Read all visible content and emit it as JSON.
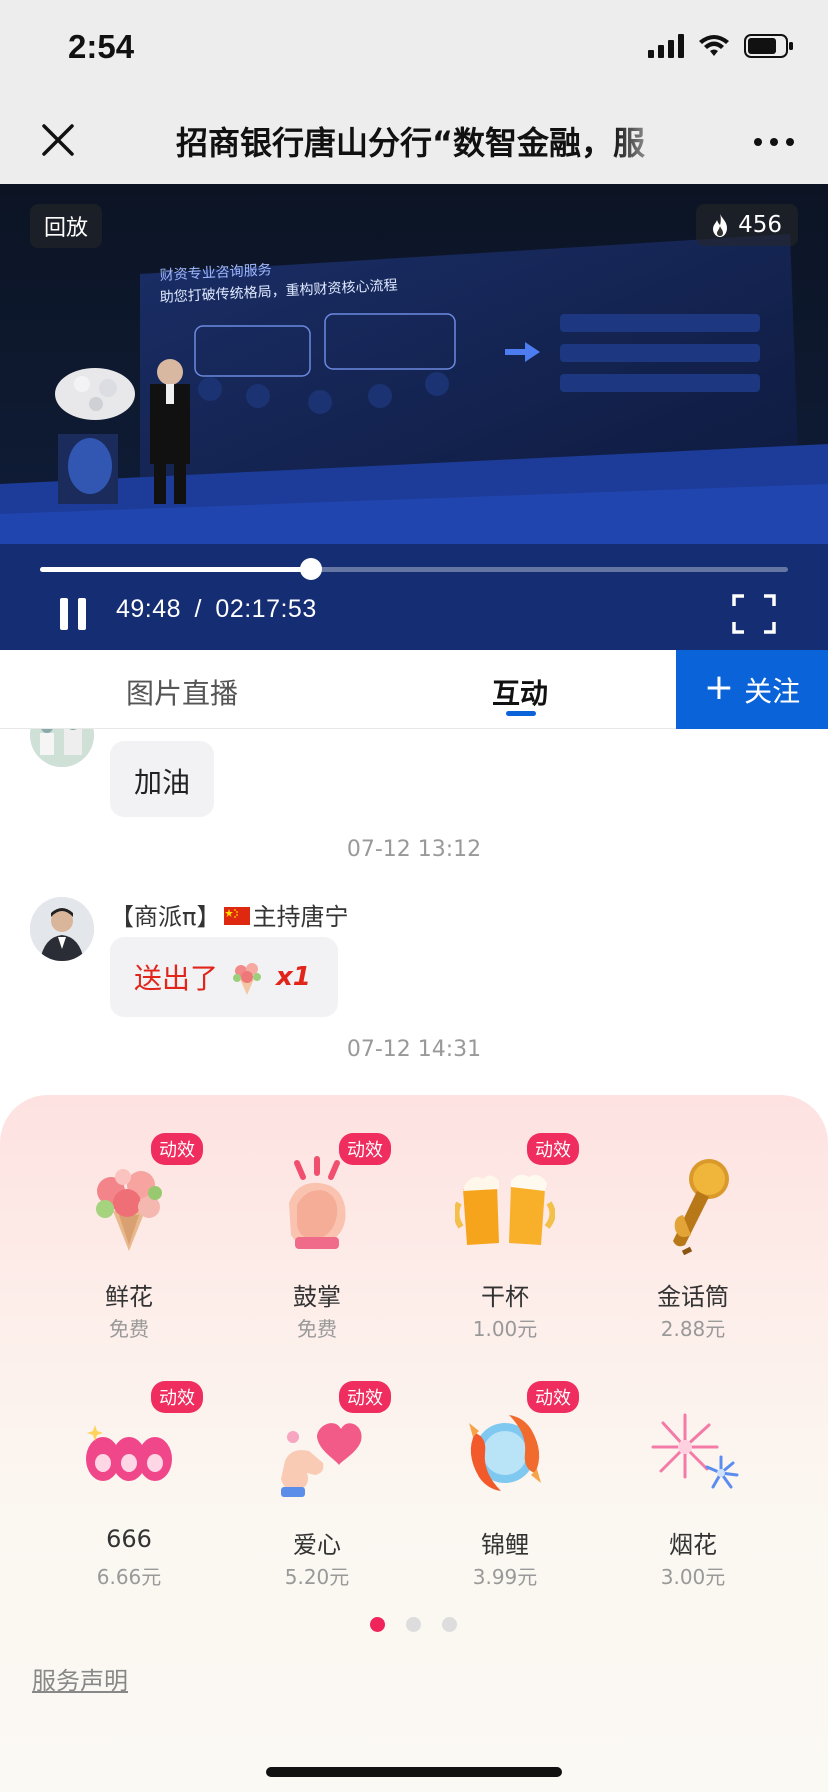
{
  "status_bar": {
    "time": "2:54"
  },
  "nav": {
    "title": "招商银行唐山分行“数智金融，服"
  },
  "video": {
    "replay_label": "回放",
    "hot_count": "456",
    "time_current": "49:48",
    "time_separator": "/",
    "time_total": "02:17:53",
    "progress_fraction": 0.3628,
    "slide_lines": [
      "财资专业咨询服务",
      "助您打破传统格局，重构财资核心流程"
    ]
  },
  "tabs": [
    {
      "label": "图片直播",
      "active": false
    },
    {
      "label": "互动",
      "active": true
    }
  ],
  "follow_button": {
    "plus": "+",
    "label": "关注"
  },
  "chat": {
    "messages": [
      {
        "text": "加油"
      },
      {
        "timestamp": "07-12 13:12"
      },
      {
        "username": "【商派π】",
        "username_suffix": "主持唐宁",
        "gift_text": "送出了",
        "gift_count": "x1"
      },
      {
        "timestamp": "07-12 14:31"
      }
    ]
  },
  "gifts": [
    {
      "name": "鲜花",
      "price": "免费",
      "badge": "动效"
    },
    {
      "name": "鼓掌",
      "price": "免费",
      "badge": "动效"
    },
    {
      "name": "干杯",
      "price": "1.00元",
      "badge": "动效"
    },
    {
      "name": "金话筒",
      "price": "2.88元",
      "badge": ""
    },
    {
      "name": "666",
      "price": "6.66元",
      "badge": "动效"
    },
    {
      "name": "爱心",
      "price": "5.20元",
      "badge": "动效"
    },
    {
      "name": "锦鲤",
      "price": "3.99元",
      "badge": "动效"
    },
    {
      "name": "烟花",
      "price": "3.00元",
      "badge": ""
    }
  ],
  "pagination": {
    "active_index": 0,
    "count": 3
  },
  "service_link": "服务声明",
  "colors": {
    "accent_blue": "#0b63d9",
    "badge_pink": "#ef2d5e",
    "gift_red": "#e1251b"
  }
}
